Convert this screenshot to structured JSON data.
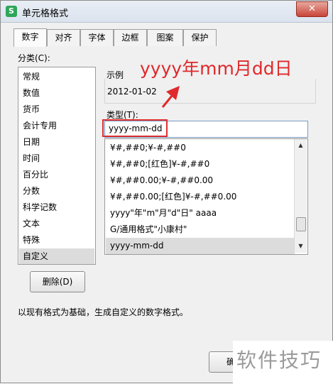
{
  "window": {
    "title": "单元格格式",
    "app_icon_glyph": "S",
    "close_glyph": "✕"
  },
  "tabs": [
    "数字",
    "对齐",
    "字体",
    "边框",
    "图案",
    "保护"
  ],
  "category": {
    "label": "分类(C):",
    "items": [
      "常规",
      "数值",
      "货币",
      "会计专用",
      "日期",
      "时间",
      "百分比",
      "分数",
      "科学记数",
      "文本",
      "特殊",
      "自定义"
    ],
    "selected": "自定义"
  },
  "sample": {
    "label": "示例",
    "value": "2012-01-02"
  },
  "type": {
    "label": "类型(T):",
    "value": "yyyy-mm-dd",
    "list": [
      "¥#,##0;¥-#,##0",
      "¥#,##0;[红色]¥-#,##0",
      "¥#,##0.00;¥-#,##0.00",
      "¥#,##0.00;[红色]¥-#,##0.00",
      "yyyy\"年\"m\"月\"d\"日\" aaaa",
      "G/通用格式\"小康村\"",
      "yyyy-mm-dd"
    ],
    "selected": "yyyy-mm-dd"
  },
  "annotation": "yyyy年mm月dd日",
  "buttons": {
    "delete": "删除(D)",
    "ok": "确"
  },
  "description": "以现有格式为基础，生成自定义的数字格式。",
  "watermark": "软件技巧",
  "colors": {
    "annotation": "#e0292b",
    "highlight_box": "#e03030"
  },
  "icons": {
    "scroll_up": "▲",
    "scroll_down": "▼"
  }
}
